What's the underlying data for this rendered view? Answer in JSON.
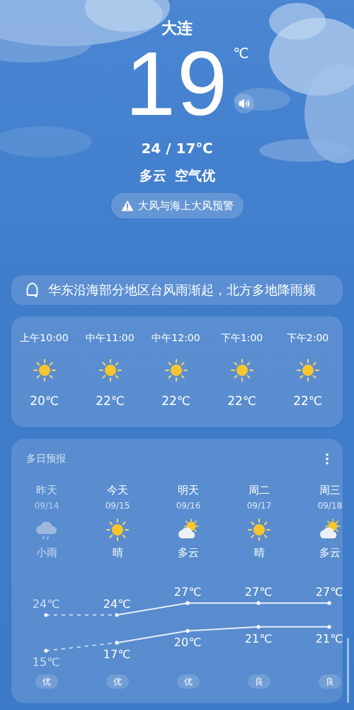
{
  "city": "大连",
  "current": {
    "temperature": "19",
    "unit": "℃",
    "range": "24 / 17℃",
    "condition": "多云",
    "air": "空气优"
  },
  "warning": "大风与海上大风预警",
  "notice": "华东沿海部分地区台风雨渐起，北方多地降雨频",
  "hourly": [
    {
      "time": "上午10:00",
      "kind": "sunny",
      "temp": "20℃"
    },
    {
      "time": "中午11:00",
      "kind": "sunny",
      "temp": "22℃"
    },
    {
      "time": "中午12:00",
      "kind": "sunny",
      "temp": "22℃"
    },
    {
      "time": "下午1:00",
      "kind": "sunny",
      "temp": "22℃"
    },
    {
      "time": "下午2:00",
      "kind": "sunny",
      "temp": "22℃"
    }
  ],
  "daily": {
    "title": "多日预报",
    "days": [
      {
        "day": "昨天",
        "date": "09/14",
        "kind": "rainy",
        "condition": "小雨",
        "high": "24℃",
        "low": "15℃",
        "aqi": "优",
        "past": true
      },
      {
        "day": "今天",
        "date": "09/15",
        "kind": "sunny",
        "condition": "晴",
        "high": "24℃",
        "low": "17℃",
        "aqi": "优",
        "past": false
      },
      {
        "day": "明天",
        "date": "09/16",
        "kind": "cloudy",
        "condition": "多云",
        "high": "27℃",
        "low": "20℃",
        "aqi": "优",
        "past": false
      },
      {
        "day": "周二",
        "date": "09/17",
        "kind": "sunny",
        "condition": "晴",
        "high": "27℃",
        "low": "21℃",
        "aqi": "良",
        "past": false
      },
      {
        "day": "周三",
        "date": "09/18",
        "kind": "cloudy",
        "condition": "多云",
        "high": "27℃",
        "low": "21℃",
        "aqi": "良",
        "past": false
      }
    ]
  }
}
